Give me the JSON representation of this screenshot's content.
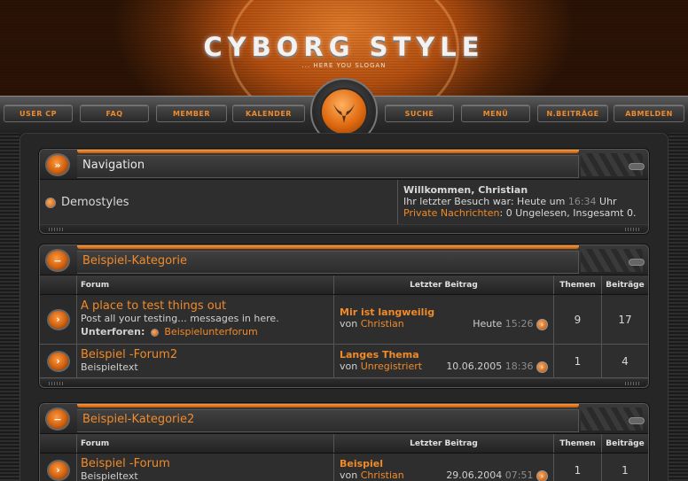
{
  "header": {
    "logo": "CYBORG STYLE",
    "slogan": "... HERE YOU SLOGAN"
  },
  "nav": {
    "items": [
      "USER CP",
      "FAQ",
      "MEMBER",
      "KALENDER",
      "SUCHE",
      "MENÜ",
      "N.BEITRÄGE",
      "ABMELDEN"
    ]
  },
  "navigation_box": {
    "title": "Navigation",
    "crumb": "Demostyles",
    "welcome_title": "Willkommen, Christian",
    "last_visit_prefix": "Ihr letzter Besuch war: Heute um",
    "last_visit_time": "16:34",
    "last_visit_suffix": "Uhr",
    "pm_link": "Private Nachrichten",
    "pm_text": ": 0 Ungelesen, Insgesamt 0."
  },
  "categories": [
    {
      "title": "Beispiel-Kategorie",
      "headers": {
        "forum": "Forum",
        "last": "Letzter Beitrag",
        "themen": "Themen",
        "beitraege": "Beiträge"
      },
      "forums": [
        {
          "title": "A place to test things out",
          "desc": "Post all your testing... messages in here.",
          "subforum_label": "Unterforen:",
          "subforum": "Beispielunterforum",
          "last_title": "Mir ist langweilig",
          "last_by_prefix": "von",
          "last_by": "Christian",
          "last_date": "Heute",
          "last_time": "15:26",
          "themen": "9",
          "beitraege": "17"
        },
        {
          "title": "Beispiel -Forum2",
          "desc": "Beispieltext",
          "last_title": "Langes Thema",
          "last_by_prefix": "von",
          "last_by": "Unregistriert",
          "last_date": "10.06.2005",
          "last_time": "18:36",
          "themen": "1",
          "beitraege": "4"
        }
      ]
    },
    {
      "title": "Beispiel-Kategorie2",
      "headers": {
        "forum": "Forum",
        "last": "Letzter Beitrag",
        "themen": "Themen",
        "beitraege": "Beiträge"
      },
      "forums": [
        {
          "title": "Beispiel -Forum",
          "desc": "Beispieltext",
          "last_title": "Beispiel",
          "last_by_prefix": "von",
          "last_by": "Christian",
          "last_date": "29.06.2004",
          "last_time": "07:51",
          "themen": "1",
          "beitraege": "1"
        }
      ]
    }
  ],
  "colors": {
    "accent": "#f08a2a",
    "background": "#1c1c1c",
    "panel": "#2e2e2e"
  }
}
